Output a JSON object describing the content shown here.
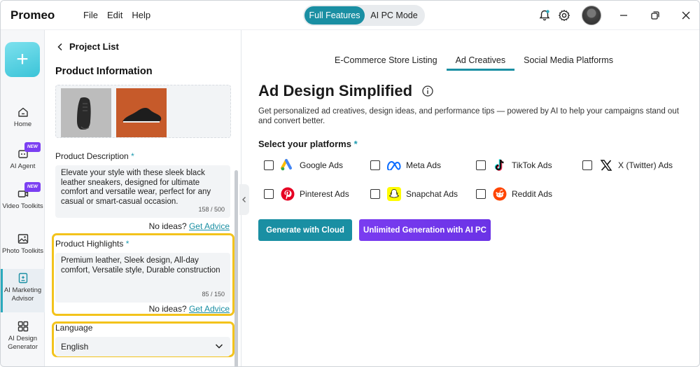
{
  "app": {
    "name": "Promeo"
  },
  "menu": [
    "File",
    "Edit",
    "Help"
  ],
  "mode_switch": {
    "active": "Full Features",
    "inactive": "AI PC Mode"
  },
  "titlebar_icons": [
    "bell-icon",
    "gear-icon",
    "avatar",
    "minimize-icon",
    "restore-icon",
    "close-icon"
  ],
  "leftnav": {
    "add_label": "+",
    "items": [
      {
        "label": "Home",
        "icon": "home-icon",
        "badge": ""
      },
      {
        "label": "AI Agent",
        "icon": "ai-agent-icon",
        "badge": "NEW"
      },
      {
        "label": "Video Toolkits",
        "icon": "video-icon",
        "badge": "NEW"
      },
      {
        "label": "Photo Toolkits",
        "icon": "photo-icon",
        "badge": ""
      },
      {
        "label": "AI Marketing Advisor",
        "icon": "marketing-icon",
        "badge": ""
      },
      {
        "label": "AI Design Generator",
        "icon": "grid-icon",
        "badge": ""
      }
    ]
  },
  "panel": {
    "back_label": "Project List",
    "section_title": "Product Information",
    "description": {
      "label": "Product Description",
      "required": "*",
      "text": "Elevate your style with these sleek black leather sneakers, designed for ultimate comfort and versatile wear, perfect for any casual or smart-casual occasion.",
      "counter": "158 / 500"
    },
    "no_ideas": "No ideas?",
    "get_advice": "Get Advice",
    "highlights": {
      "label": "Product Highlights",
      "required": "*",
      "text": "Premium leather, Sleek design, All-day comfort, Versatile style, Durable construction",
      "counter": "85 / 150"
    },
    "language": {
      "label": "Language",
      "value": "English"
    }
  },
  "tabs": [
    {
      "label": "E-Commerce Store Listing",
      "active": false
    },
    {
      "label": "Ad Creatives",
      "active": true
    },
    {
      "label": "Social Media Platforms",
      "active": false
    }
  ],
  "main": {
    "title": "Ad Design Simplified",
    "subtitle": "Get personalized ad creatives, design ideas, and performance tips — powered by AI to help your campaigns stand out and convert better.",
    "platforms_label": "Select your platforms",
    "platforms_required": "*",
    "platforms": [
      {
        "label": "Google Ads",
        "checked": false
      },
      {
        "label": "Meta Ads",
        "checked": false
      },
      {
        "label": "TikTok Ads",
        "checked": false
      },
      {
        "label": "X (Twitter) Ads",
        "checked": false
      },
      {
        "label": "Pinterest Ads",
        "checked": false
      },
      {
        "label": "Snapchat Ads",
        "checked": false
      },
      {
        "label": "Reddit Ads",
        "checked": false
      }
    ],
    "btn_cloud": "Generate with Cloud",
    "btn_aipc": "Unlimited Generation with AI PC"
  },
  "colors": {
    "accent": "#1a8fa3",
    "purple": "#7a3cf0",
    "highlight": "#f3c31b"
  }
}
